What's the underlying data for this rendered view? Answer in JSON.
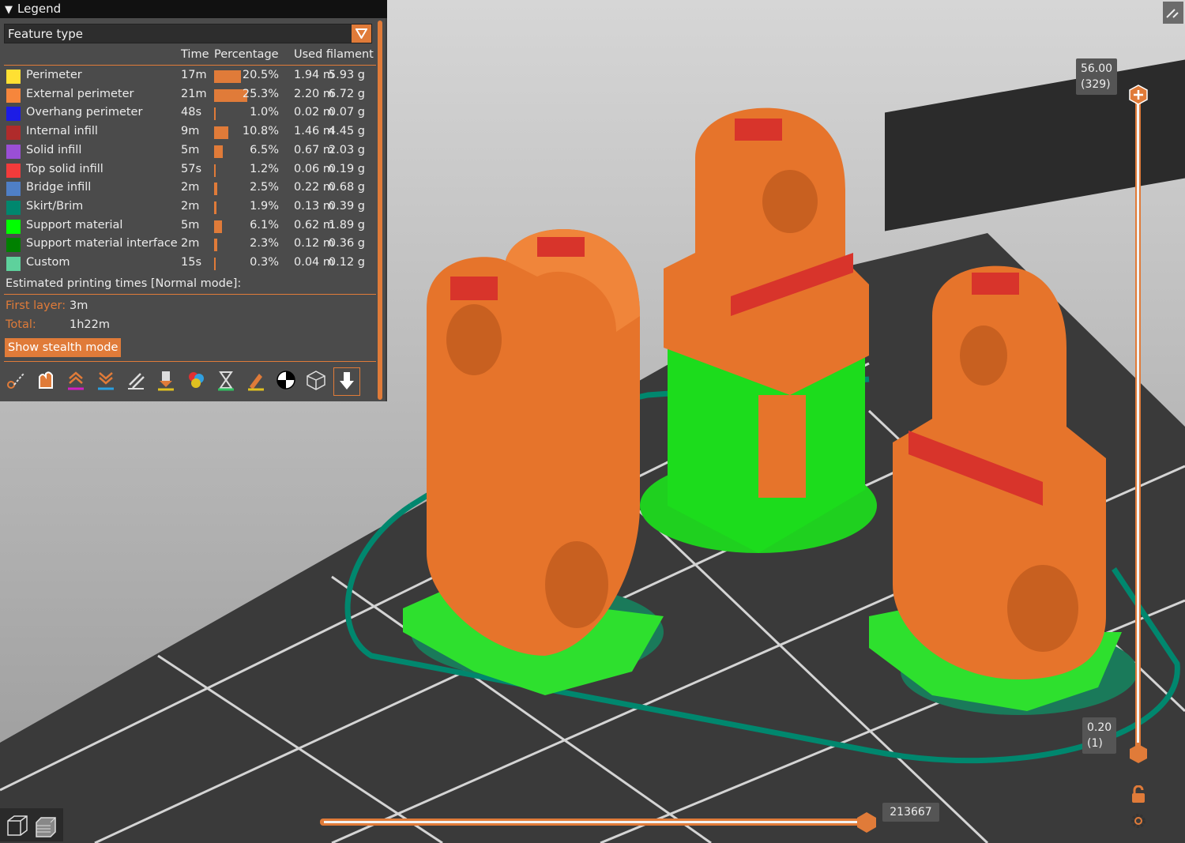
{
  "legend": {
    "title": "Legend",
    "view_type": "Feature type",
    "columns": {
      "time": "Time",
      "percentage": "Percentage",
      "used_filament": "Used filament"
    },
    "rows": [
      {
        "name": "Perimeter",
        "color": "#ffe033",
        "time": "17m",
        "pct": "20.5%",
        "frac": 0.81,
        "length": "1.94 m",
        "weight": "5.93 g"
      },
      {
        "name": "External perimeter",
        "color": "#f6863c",
        "time": "21m",
        "pct": "25.3%",
        "frac": 1.0,
        "length": "2.20 m",
        "weight": "6.72 g"
      },
      {
        "name": "Overhang perimeter",
        "color": "#1c1ce6",
        "time": "48s",
        "pct": "1.0%",
        "frac": 0.04,
        "length": "0.02 m",
        "weight": "0.07 g"
      },
      {
        "name": "Internal infill",
        "color": "#b02b2b",
        "time": "9m",
        "pct": "10.8%",
        "frac": 0.43,
        "length": "1.46 m",
        "weight": "4.45 g"
      },
      {
        "name": "Solid infill",
        "color": "#9a4fd6",
        "time": "5m",
        "pct": "6.5%",
        "frac": 0.26,
        "length": "0.67 m",
        "weight": "2.03 g"
      },
      {
        "name": "Top solid infill",
        "color": "#f23b3b",
        "time": "57s",
        "pct": "1.2%",
        "frac": 0.05,
        "length": "0.06 m",
        "weight": "0.19 g"
      },
      {
        "name": "Bridge infill",
        "color": "#4f7fc6",
        "time": "2m",
        "pct": "2.5%",
        "frac": 0.1,
        "length": "0.22 m",
        "weight": "0.68 g"
      },
      {
        "name": "Skirt/Brim",
        "color": "#00876e",
        "time": "2m",
        "pct": "1.9%",
        "frac": 0.075,
        "length": "0.13 m",
        "weight": "0.39 g"
      },
      {
        "name": "Support material",
        "color": "#00ff00",
        "time": "5m",
        "pct": "6.1%",
        "frac": 0.24,
        "length": "0.62 m",
        "weight": "1.89 g"
      },
      {
        "name": "Support material interface",
        "color": "#008000",
        "time": "2m",
        "pct": "2.3%",
        "frac": 0.09,
        "length": "0.12 m",
        "weight": "0.36 g"
      },
      {
        "name": "Custom",
        "color": "#5ed19c",
        "time": "15s",
        "pct": "0.3%",
        "frac": 0.012,
        "length": "0.04 m",
        "weight": "0.12 g"
      }
    ],
    "estimated_label": "Estimated printing times [Normal mode]:",
    "first_layer_label": "First layer:",
    "first_layer_value": "3m",
    "total_label": "Total:",
    "total_value": "1h22m",
    "stealth_button": "Show stealth mode",
    "tools": [
      "travel-icon",
      "wipe-icon",
      "retractions-icon",
      "deretractions-icon",
      "seams-icon",
      "tool-changes-icon",
      "color-changes-icon",
      "pause-icon",
      "custom-gcode-icon",
      "center-of-gravity-icon",
      "shells-icon",
      "tool-marker-icon"
    ]
  },
  "vertical_slider": {
    "top_value": "56.00",
    "top_layer": "(329)",
    "bottom_value": "0.20",
    "bottom_layer": "(1)"
  },
  "horizontal_slider": {
    "value": "213667"
  },
  "accent": "#e07b39"
}
